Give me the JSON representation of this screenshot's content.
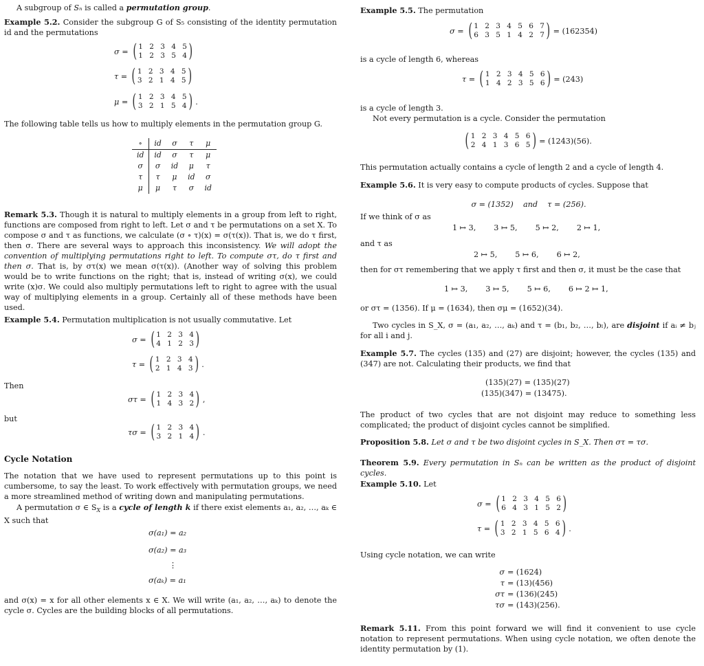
{
  "left": {
    "intro": {
      "pre": "A subgroup of ",
      "sym": "Sₙ",
      "mid": " is called a ",
      "term": "permutation group",
      "post": "."
    },
    "ex52": {
      "label": "Example 5.2.",
      "text": "Consider the subgroup G of S₅ consisting of the identity permutation id and the permutations",
      "perms": [
        {
          "name": "σ =",
          "top": [
            "1",
            "2",
            "3",
            "4",
            "5"
          ],
          "bottom": [
            "1",
            "2",
            "3",
            "5",
            "4"
          ],
          "end": ""
        },
        {
          "name": "τ =",
          "top": [
            "1",
            "2",
            "3",
            "4",
            "5"
          ],
          "bottom": [
            "3",
            "2",
            "1",
            "4",
            "5"
          ],
          "end": ""
        },
        {
          "name": "μ =",
          "top": [
            "1",
            "2",
            "3",
            "4",
            "5"
          ],
          "bottom": [
            "3",
            "2",
            "1",
            "5",
            "4"
          ],
          "end": "."
        }
      ],
      "after": "The following table tells us how to multiply elements in the permutation group G."
    },
    "cayley": {
      "header": [
        "∘",
        "id",
        "σ",
        "τ",
        "μ"
      ],
      "rows": [
        [
          "id",
          "id",
          "σ",
          "τ",
          "μ"
        ],
        [
          "σ",
          "σ",
          "id",
          "μ",
          "τ"
        ],
        [
          "τ",
          "τ",
          "μ",
          "id",
          "σ"
        ],
        [
          "μ",
          "μ",
          "τ",
          "σ",
          "id"
        ]
      ]
    },
    "rem53": {
      "label": "Remark 5.3.",
      "t1": "Though it is natural to multiply elements in a group from left to right, functions are composed from right to left. Let σ and τ be permutations on a set X. To compose σ and τ as functions, we calculate (σ ∘ τ)(x) = σ(τ(x)). That is, we do τ first, then σ. There are several ways to approach this inconsistency. ",
      "italic": "We will adopt the convention of multiplying permutations right to left. To compute στ, do τ first and then σ.",
      "t2": " That is, by στ(x) we mean σ(τ(x)). (Another way of solving this problem would be to write functions on the right; that is, instead of writing σ(x), we could write (x)σ. We could also multiply permutations left to right to agree with the usual way of multiplying elements in a group. Certainly all of these methods have been used."
    },
    "ex54": {
      "label": "Example 5.4.",
      "text": "Permutation multiplication is not usually commutative. Let",
      "perms": [
        {
          "name": "σ =",
          "top": [
            "1",
            "2",
            "3",
            "4"
          ],
          "bottom": [
            "4",
            "1",
            "2",
            "3"
          ],
          "end": ""
        },
        {
          "name": "τ =",
          "top": [
            "1",
            "2",
            "3",
            "4"
          ],
          "bottom": [
            "2",
            "1",
            "4",
            "3"
          ],
          "end": "."
        }
      ],
      "then": "Then",
      "prod1": {
        "name": "στ =",
        "top": [
          "1",
          "2",
          "3",
          "4"
        ],
        "bottom": [
          "1",
          "4",
          "3",
          "2"
        ],
        "end": ","
      },
      "but": "but",
      "prod2": {
        "name": "τσ =",
        "top": [
          "1",
          "2",
          "3",
          "4"
        ],
        "bottom": [
          "3",
          "2",
          "1",
          "4"
        ],
        "end": "."
      }
    },
    "cycle": {
      "heading": "Cycle Notation",
      "p1": "The notation that we have used to represent permutations up to this point is cumbersome, to say the least. To work effectively with permutation groups, we need a more streamlined method of writing down and manipulating permutations.",
      "p2a": "A permutation σ ∈ S",
      "p2sub": "X",
      "p2b": " is a ",
      "p2term": "cycle of length k",
      "p2c": " if there exist elements a₁, a₂, …, aₖ ∈ X such that",
      "eqs": [
        "σ(a₁) = a₂",
        "σ(a₂) = a₃",
        "⋮",
        "σ(aₖ) = a₁"
      ],
      "p3": "and σ(x) = x for all other elements x ∈ X. We will write (a₁, a₂, …, aₖ) to denote the cycle σ. Cycles are the building blocks of all permutations."
    }
  },
  "right": {
    "ex55": {
      "label": "Example 5.5.",
      "text": "The permutation",
      "p1": {
        "name": "σ =",
        "top": [
          "1",
          "2",
          "3",
          "4",
          "5",
          "6",
          "7"
        ],
        "bottom": [
          "6",
          "3",
          "5",
          "1",
          "4",
          "2",
          "7"
        ],
        "end": "= (162354)"
      },
      "mid": "is a cycle of length 6, whereas",
      "p2": {
        "name": "τ =",
        "top": [
          "1",
          "2",
          "3",
          "4",
          "5",
          "6"
        ],
        "bottom": [
          "1",
          "4",
          "2",
          "3",
          "5",
          "6"
        ],
        "end": "= (243)"
      },
      "after": "is a cycle of length 3.",
      "not_every": "Not every permutation is a cycle. Consider the permutation",
      "p3": {
        "name": "",
        "top": [
          "1",
          "2",
          "3",
          "4",
          "5",
          "6"
        ],
        "bottom": [
          "2",
          "4",
          "1",
          "3",
          "6",
          "5"
        ],
        "end": "= (1243)(56)."
      },
      "contains": "This permutation actually contains a cycle of length 2 and a cycle of length 4."
    },
    "ex56": {
      "label": "Example 5.6.",
      "text": "It is very easy to compute products of cycles. Suppose that",
      "eq": "σ = (1352)    and    τ = (256).",
      "think_sigma": "If we think of σ as",
      "sigma_maps": [
        "1 ↦ 3,",
        "3 ↦ 5,",
        "5 ↦ 2,",
        "2 ↦ 1,"
      ],
      "and_tau": "and τ as",
      "tau_maps": [
        "2 ↦ 5,",
        "5 ↦ 6,",
        "6 ↦ 2,"
      ],
      "then_for": "then for στ remembering that we apply τ first and then σ, it must be the case that",
      "prod_maps": [
        "1 ↦ 3,",
        "3 ↦ 5,",
        "5 ↦ 6,",
        "6 ↦ 2 ↦ 1,"
      ],
      "result": "or στ = (1356). If μ = (1634), then σμ = (1652)(34)."
    },
    "disjoint": {
      "pre": "Two cycles in S_X, σ = (a₁, a₂, …, aₖ) and τ = (b₁, b₂, …, bₗ), are ",
      "term": "disjoint",
      "post": " if aᵢ ≠ bⱼ for all i and j."
    },
    "ex57": {
      "label": "Example 5.7.",
      "text": "The cycles (135) and (27) are disjoint; however, the cycles (135) and (347) are not. Calculating their products, we find that",
      "eqs": [
        "(135)(27) = (135)(27)",
        "(135)(347) = (13475)."
      ],
      "after": "The product of two cycles that are not disjoint may reduce to something less complicated; the product of disjoint cycles cannot be simplified."
    },
    "prop58": {
      "label": "Proposition 5.8.",
      "text": "Let σ and τ be two disjoint cycles in S_X. Then στ = τσ."
    },
    "thm59": {
      "label": "Theorem 5.9.",
      "text": "Every permutation in Sₙ can be written as the product of disjoint cycles."
    },
    "ex510": {
      "label": "Example 5.10.",
      "text": "Let",
      "perms": [
        {
          "name": "σ =",
          "top": [
            "1",
            "2",
            "3",
            "4",
            "5",
            "6"
          ],
          "bottom": [
            "6",
            "4",
            "3",
            "1",
            "5",
            "2"
          ],
          "end": ""
        },
        {
          "name": "τ =",
          "top": [
            "1",
            "2",
            "3",
            "4",
            "5",
            "6"
          ],
          "bottom": [
            "3",
            "2",
            "1",
            "5",
            "6",
            "4"
          ],
          "end": "."
        }
      ],
      "using": "Using cycle notation, we can write",
      "eqs": [
        {
          "lhs": "σ",
          "rhs": "= (1624)"
        },
        {
          "lhs": "τ",
          "rhs": "= (13)(456)"
        },
        {
          "lhs": "στ",
          "rhs": "= (136)(245)"
        },
        {
          "lhs": "τσ",
          "rhs": "= (143)(256)."
        }
      ]
    },
    "rem511": {
      "label": "Remark 5.11.",
      "text": "From this point forward we will find it convenient to use cycle notation to represent permutations. When using cycle notation, we often denote the identity permutation by (1)."
    }
  }
}
